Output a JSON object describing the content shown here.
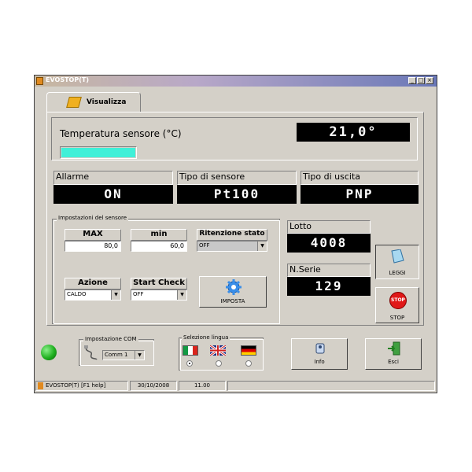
{
  "window": {
    "title": "EVOSTOP(T)"
  },
  "tab": {
    "label": "Visualizza"
  },
  "temperature": {
    "label": "Temperatura sensore (°C)",
    "value": "21,0°",
    "bar_fill_color": "#40f0d8"
  },
  "allarme": {
    "label": "Allarme",
    "value": "ON"
  },
  "tipo_sensore": {
    "label": "Tipo di sensore",
    "value": "Pt100"
  },
  "tipo_uscita": {
    "label": "Tipo di uscita",
    "value": "PNP"
  },
  "impostazioni": {
    "title": "Impostazioni del sensore",
    "max": {
      "label": "MAX",
      "value": "80,0"
    },
    "min": {
      "label": "min",
      "value": "60,0"
    },
    "ritenzione": {
      "label": "Ritenzione stato",
      "value": "OFF"
    },
    "azione": {
      "label": "Azione",
      "value": "CALDO"
    },
    "start_check": {
      "label": "Start Check",
      "value": "OFF"
    },
    "imposta_button": "IMPOSTA"
  },
  "lotto": {
    "label": "Lotto",
    "value": "4008"
  },
  "nserie": {
    "label": "N.Serie",
    "value": "129"
  },
  "leggi_button": "LEGGI",
  "stop_button": {
    "label": "STOP",
    "icon_text": "STOP"
  },
  "com": {
    "title": "Impostazione COM",
    "port": "Comm 1"
  },
  "lingua": {
    "title": "Selezione lingua",
    "options": [
      "italiano",
      "english",
      "deutsch"
    ],
    "selected": 0
  },
  "info_button": "Info",
  "esci_button": "Esci",
  "statusbar": {
    "app": "EVOSTOP(T) [F1 help]",
    "date": "30/10/2008",
    "time": "11.00"
  },
  "colors": {
    "led": "#20b020",
    "lcd_bg": "#000000",
    "lcd_fg": "#ffffff",
    "stop_red": "#e01818"
  }
}
